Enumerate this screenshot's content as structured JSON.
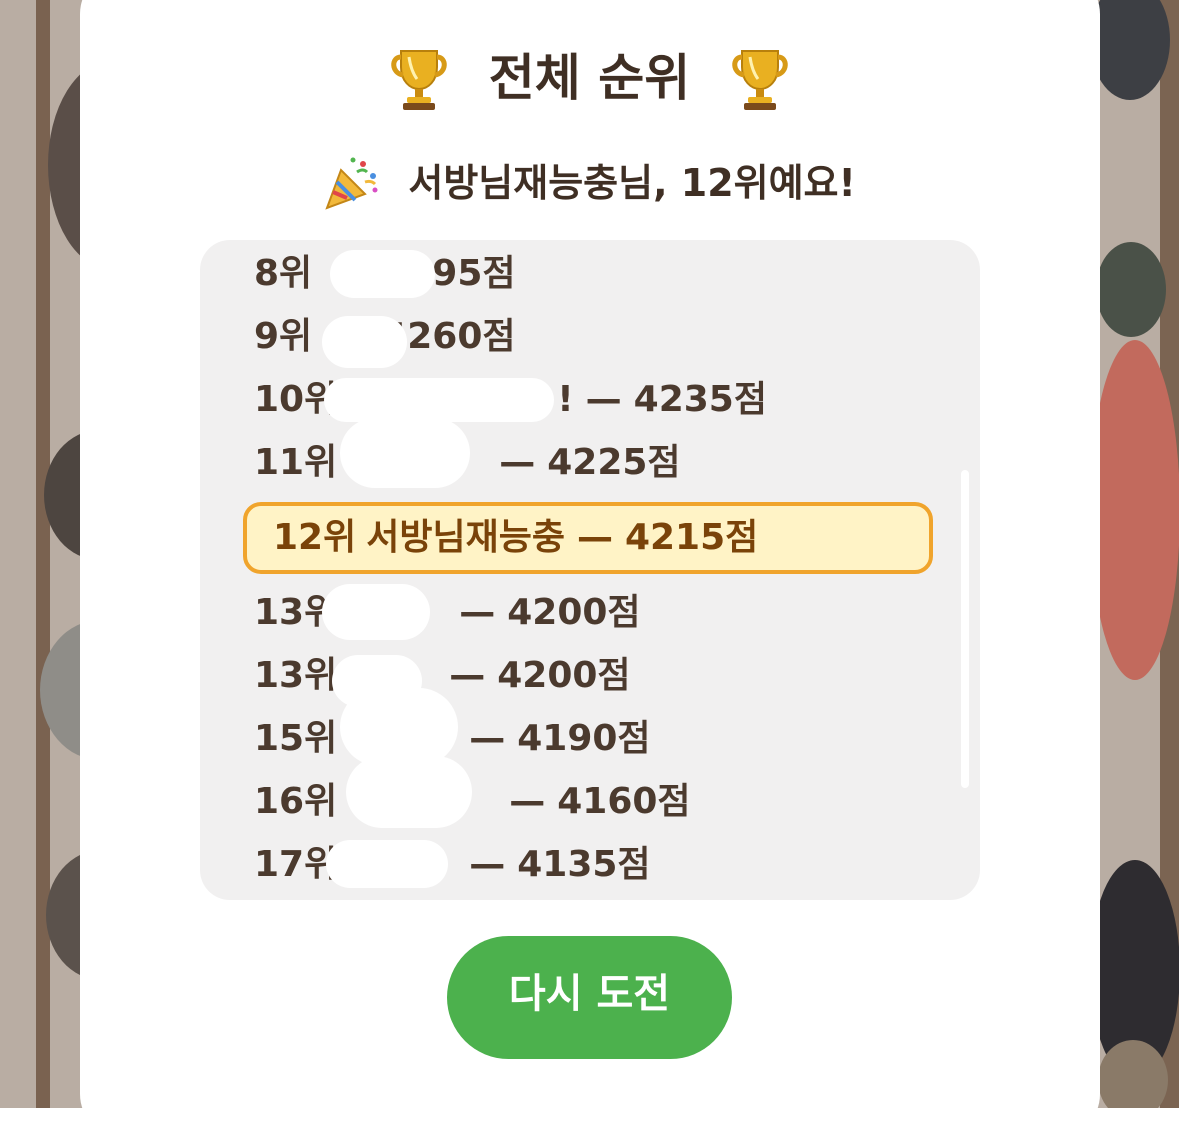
{
  "header": {
    "title": "전체 순위",
    "icon_left": "trophy-icon",
    "icon_right": "trophy-icon"
  },
  "result": {
    "icon": "party-popper-icon",
    "message": "서방님재능충님, 12위예요!"
  },
  "rankings": [
    {
      "rank": "8위",
      "name": "",
      "score": "4295점"
    },
    {
      "rank": "9위",
      "name": "",
      "score": "4260점"
    },
    {
      "rank": "10위",
      "name": "!",
      "score": "4235점"
    },
    {
      "rank": "11위",
      "name": "",
      "score": "4225점"
    },
    {
      "rank": "12위",
      "name": "서방님재능충",
      "score": "4215점",
      "is_current_user": true
    },
    {
      "rank": "13위",
      "name": "",
      "score": "4200점"
    },
    {
      "rank": "13위",
      "name": "",
      "score": "4200점"
    },
    {
      "rank": "15위",
      "name": "",
      "score": "4190점"
    },
    {
      "rank": "16위",
      "name": "",
      "score": "4160점"
    },
    {
      "rank": "17위",
      "name": "",
      "score": "4135점"
    }
  ],
  "separator": "—",
  "actions": {
    "retry_label": "다시 도전"
  },
  "colors": {
    "highlight_bg": "#fff3c6",
    "highlight_border": "#f0a42c",
    "button": "#4cb14d",
    "text": "#3f2f24"
  }
}
